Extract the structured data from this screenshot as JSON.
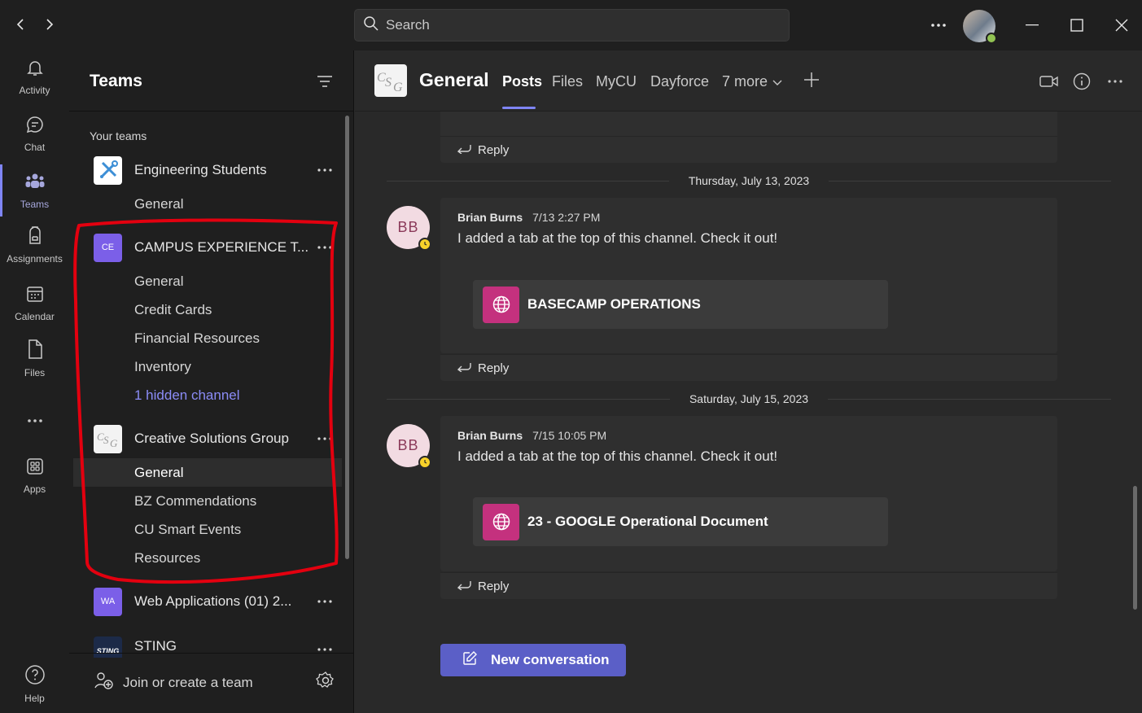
{
  "titlebar": {
    "search_placeholder": "Search",
    "more_icon": "more-horizontal-icon",
    "back_icon": "chevron-left-icon",
    "forward_icon": "chevron-right-icon"
  },
  "rail": {
    "items": [
      {
        "label": "Activity",
        "icon": "bell-icon"
      },
      {
        "label": "Chat",
        "icon": "chat-icon"
      },
      {
        "label": "Teams",
        "icon": "teams-icon",
        "active": true
      },
      {
        "label": "Assignments",
        "icon": "backpack-icon"
      },
      {
        "label": "Calendar",
        "icon": "calendar-icon"
      },
      {
        "label": "Files",
        "icon": "file-icon"
      },
      {
        "label": "Apps",
        "icon": "apps-icon"
      },
      {
        "label": "Help",
        "icon": "help-icon"
      }
    ]
  },
  "teams_panel": {
    "title": "Teams",
    "section_label": "Your teams",
    "teams": [
      {
        "name": "Engineering Students",
        "tile_text": "",
        "tile_color": "#ffffff",
        "channels": [
          "General"
        ]
      },
      {
        "name": "CAMPUS EXPERIENCE T...",
        "tile_text": "CE",
        "tile_color": "#7b5fe8",
        "channels": [
          "General",
          "Credit Cards",
          "Financial Resources",
          "Inventory"
        ],
        "hidden_channels": "1 hidden channel"
      },
      {
        "name": "Creative Solutions Group",
        "tile_text": "CSG",
        "tile_color": "#f3f3f3",
        "channels": [
          "General",
          "BZ Commendations",
          "CU Smart Events",
          "Resources"
        ]
      },
      {
        "name": "Web Applications (01) 2...",
        "tile_text": "WA",
        "tile_color": "#7b5fe8",
        "channels": []
      },
      {
        "name": "STING",
        "tile_text": "STING",
        "tile_color": "#1c2a48",
        "channels": []
      }
    ],
    "join_label": "Join or create a team"
  },
  "channel_header": {
    "title": "General",
    "logo_text": "CSG",
    "tabs": [
      "Posts",
      "Files",
      "MyCU",
      "Dayforce",
      "7 more"
    ]
  },
  "messages": {
    "reply_label": "Reply",
    "items": [
      {
        "date": "Thursday, July 13, 2023",
        "author": "Brian Burns",
        "initials": "BB",
        "time": "7/13 2:27 PM",
        "text": "I added a tab at the top of this channel. Check it out!",
        "tab_name": "BASECAMP OPERATIONS"
      },
      {
        "date": "Saturday, July 15, 2023",
        "author": "Brian Burns",
        "initials": "BB",
        "time": "7/15 10:05 PM",
        "text": "I added a tab at the top of this channel. Check it out!",
        "tab_name": "23 - GOOGLE Operational Document"
      }
    ]
  },
  "composer": {
    "new_conversation_label": "New conversation"
  },
  "colors": {
    "accent": "#7f85f5",
    "button": "#5b5fc7",
    "annotation": "#e3000f",
    "tab_icon": "#c4317e"
  }
}
